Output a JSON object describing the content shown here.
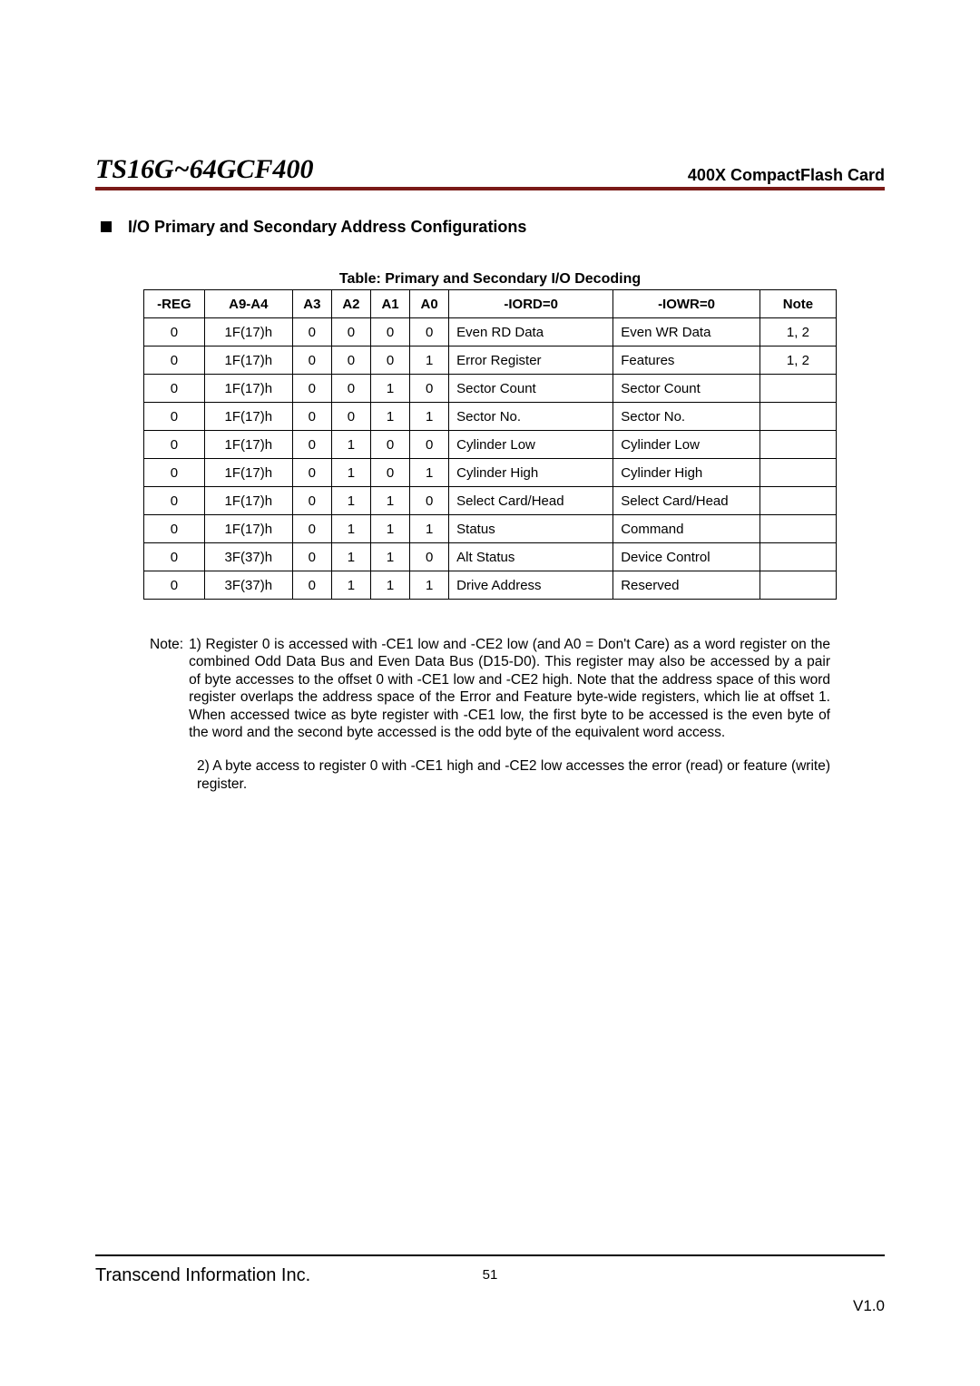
{
  "header": {
    "product": "TS16G~64GCF400",
    "subtitle": "400X CompactFlash Card"
  },
  "section": {
    "title": "I/O Primary and Secondary Address Configurations"
  },
  "table": {
    "caption": "Table: Primary and Secondary I/O Decoding",
    "headers": [
      "-REG",
      "A9-A4",
      "A3",
      "A2",
      "A1",
      "A0",
      "-IORD=0",
      "-IOWR=0",
      "Note"
    ],
    "rows": [
      {
        "reg": "0",
        "a94": "1F(17)h",
        "a3": "0",
        "a2": "0",
        "a1": "0",
        "a0": "0",
        "rd": "Even RD Data",
        "wr": "Even WR Data",
        "note": "1, 2"
      },
      {
        "reg": "0",
        "a94": "1F(17)h",
        "a3": "0",
        "a2": "0",
        "a1": "0",
        "a0": "1",
        "rd": "Error Register",
        "wr": "Features",
        "note": "1, 2"
      },
      {
        "reg": "0",
        "a94": "1F(17)h",
        "a3": "0",
        "a2": "0",
        "a1": "1",
        "a0": "0",
        "rd": "Sector Count",
        "wr": "Sector Count",
        "note": ""
      },
      {
        "reg": "0",
        "a94": "1F(17)h",
        "a3": "0",
        "a2": "0",
        "a1": "1",
        "a0": "1",
        "rd": "Sector No.",
        "wr": "Sector No.",
        "note": ""
      },
      {
        "reg": "0",
        "a94": "1F(17)h",
        "a3": "0",
        "a2": "1",
        "a1": "0",
        "a0": "0",
        "rd": "Cylinder Low",
        "wr": "Cylinder Low",
        "note": ""
      },
      {
        "reg": "0",
        "a94": "1F(17)h",
        "a3": "0",
        "a2": "1",
        "a1": "0",
        "a0": "1",
        "rd": "Cylinder High",
        "wr": "Cylinder High",
        "note": ""
      },
      {
        "reg": "0",
        "a94": "1F(17)h",
        "a3": "0",
        "a2": "1",
        "a1": "1",
        "a0": "0",
        "rd": "Select Card/Head",
        "wr": "Select Card/Head",
        "note": ""
      },
      {
        "reg": "0",
        "a94": "1F(17)h",
        "a3": "0",
        "a2": "1",
        "a1": "1",
        "a0": "1",
        "rd": "Status",
        "wr": "Command",
        "note": ""
      },
      {
        "reg": "0",
        "a94": "3F(37)h",
        "a3": "0",
        "a2": "1",
        "a1": "1",
        "a0": "0",
        "rd": "Alt Status",
        "wr": "Device Control",
        "note": ""
      },
      {
        "reg": "0",
        "a94": "3F(37)h",
        "a3": "0",
        "a2": "1",
        "a1": "1",
        "a0": "1",
        "rd": "Drive Address",
        "wr": "Reserved",
        "note": ""
      }
    ]
  },
  "notes": {
    "label": "Note:",
    "n1": "1) Register 0 is accessed with -CE1 low and -CE2 low (and A0 = Don't Care) as a word register on the combined Odd Data Bus and Even Data Bus (D15-D0). This register may also be accessed by a pair of byte accesses to the offset 0 with -CE1 low and -CE2 high. Note that the address space of this word register overlaps the address space of the Error and Feature byte-wide registers, which lie at offset 1. When accessed twice as byte register with -CE1 low, the first byte to be accessed is the even byte of the word and the second byte accessed is the odd byte of the equivalent word access.",
    "n2": "2) A byte access to register 0 with -CE1 high and -CE2 low accesses the error (read) or feature (write) register."
  },
  "footer": {
    "company": "Transcend Information Inc.",
    "page": "51",
    "version": "V1.0"
  }
}
